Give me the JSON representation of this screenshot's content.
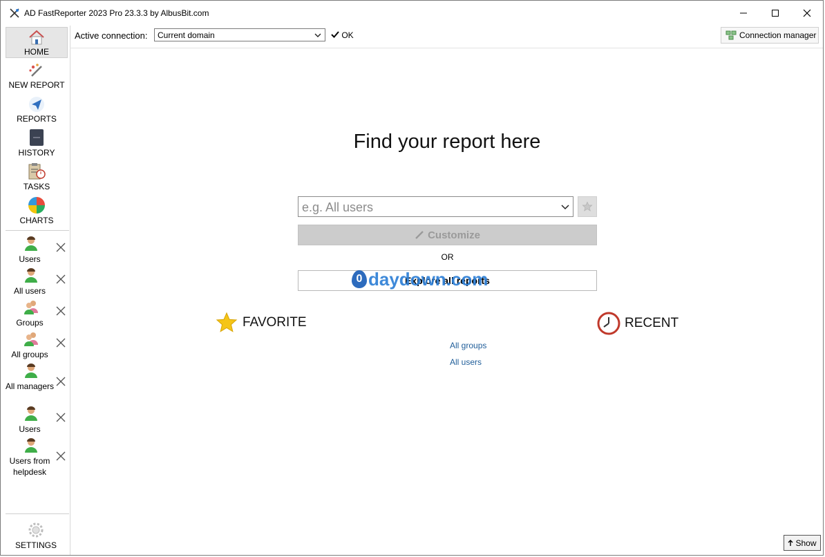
{
  "window": {
    "title": "AD FastReporter 2023 Pro 23.3.3 by AlbusBit.com",
    "controls": [
      "minimize",
      "maximize",
      "close"
    ]
  },
  "sidebar": {
    "nav": [
      {
        "label": "HOME",
        "icon": "home-icon",
        "active": true
      },
      {
        "label": "NEW REPORT",
        "icon": "magic-wand-icon"
      },
      {
        "label": "REPORTS",
        "icon": "paper-plane-icon"
      },
      {
        "label": "HISTORY",
        "icon": "archive-box-icon"
      },
      {
        "label": "TASKS",
        "icon": "clipboard-clock-icon"
      },
      {
        "label": "CHARTS",
        "icon": "pie-chart-icon"
      }
    ],
    "report_tabs": [
      {
        "label": "Users",
        "icon": "user-icon"
      },
      {
        "label": "All users",
        "icon": "user-icon"
      },
      {
        "label": "Groups",
        "icon": "group-icon"
      },
      {
        "label": "All groups",
        "icon": "group-icon"
      },
      {
        "label": "All managers",
        "icon": "user-icon"
      },
      {
        "label": "Users",
        "icon": "user-icon"
      },
      {
        "label": "Users from helpdesk",
        "icon": "user-icon"
      }
    ],
    "settings_label": "SETTINGS"
  },
  "topbar": {
    "active_connection_label": "Active connection:",
    "connection_value": "Current domain",
    "status_text": "OK",
    "connection_manager_label": "Connection manager"
  },
  "main": {
    "heading": "Find your report here",
    "search_placeholder": "e.g. All users",
    "customize_label": "Customize",
    "or_text": "OR",
    "explore_label": "Explore all reports",
    "watermark": "daydown.com",
    "favorite_title": "FAVORITE",
    "recent_title": "RECENT",
    "recent_items": [
      "All groups",
      "All users"
    ]
  },
  "footer": {
    "show_label": "Show"
  },
  "colors": {
    "link": "#1f5d99",
    "customize_bg": "#cccccc",
    "watermark": "#2e7fd6"
  }
}
